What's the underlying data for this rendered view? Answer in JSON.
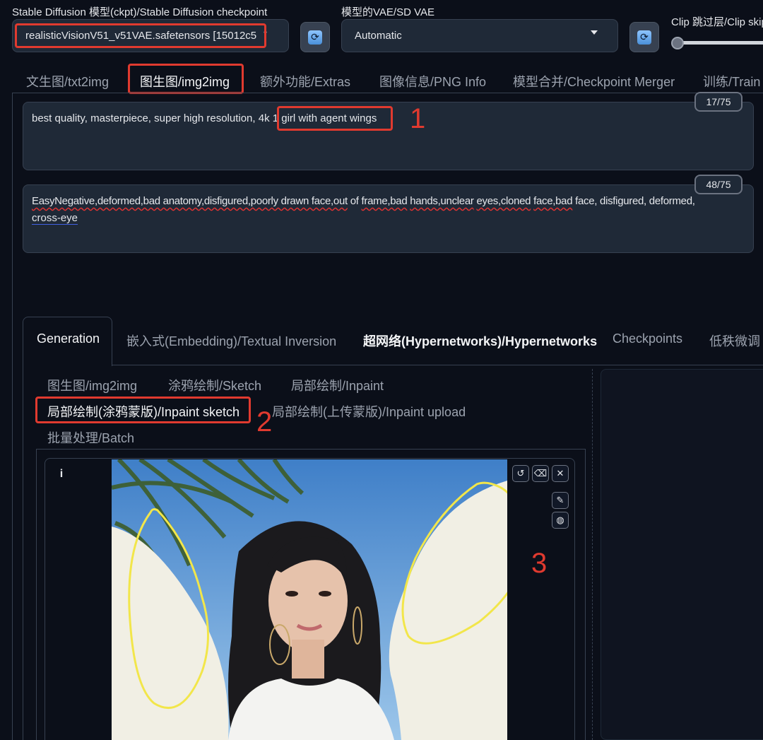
{
  "header": {
    "checkpoint_label": "Stable Diffusion 模型(ckpt)/Stable Diffusion checkpoint",
    "checkpoint_value": "realisticVisionV51_v51VAE.safetensors [15012c5",
    "vae_label": "模型的VAE/SD VAE",
    "vae_value": "Automatic",
    "clip_label": "Clip 跳过层/Clip skip",
    "refresh_icon": "refresh-icon"
  },
  "tabs": [
    {
      "label": "文生图/txt2img"
    },
    {
      "label": "图生图/img2img"
    },
    {
      "label": "额外功能/Extras"
    },
    {
      "label": "图像信息/PNG Info"
    },
    {
      "label": "模型合并/Checkpoint Merger"
    },
    {
      "label": "训练/Train"
    }
  ],
  "prompt": {
    "positive_prefix": "best quality, masterpiece, super high resolution, 4k",
    "positive_highlight": "1 girl with agent wings",
    "positive_count": "17/75",
    "negative_line1": [
      {
        "t": "EasyNegative,deformed,bad anatomy,disfigured,poorly drawn ",
        "w": true
      },
      {
        "t": "face,out",
        "w": true
      },
      {
        "t": " of ",
        "w": false
      },
      {
        "t": "frame,bad",
        "w": true
      },
      {
        "t": " ",
        "w": false
      },
      {
        "t": "hands,unclear",
        "w": true
      },
      {
        "t": " ",
        "w": false
      },
      {
        "t": "eyes,cloned",
        "w": true
      },
      {
        "t": " ",
        "w": false
      },
      {
        "t": "face,bad",
        "w": true
      },
      {
        "t": " face, disfigured, deformed,",
        "w": false
      }
    ],
    "negative_line2": "cross-eye",
    "negative_count": "48/75"
  },
  "gen_tabs": [
    {
      "label": "Generation"
    },
    {
      "label": "嵌入式(Embedding)/Textual Inversion"
    },
    {
      "label": "超网络(Hypernetworks)/Hypernetworks"
    },
    {
      "label": "Checkpoints"
    },
    {
      "label": "低秩微调"
    }
  ],
  "sub_tabs": [
    {
      "label": "图生图/img2img"
    },
    {
      "label": "涂鸦绘制/Sketch"
    },
    {
      "label": "局部绘制/Inpaint"
    },
    {
      "label": "局部绘制(涂鸦蒙版)/Inpaint sketch"
    },
    {
      "label": "局部绘制(上传蒙版)/Inpaint upload"
    },
    {
      "label": "批量处理/Batch"
    }
  ],
  "canvas": {
    "info_glyph": "i",
    "tools": [
      "undo-icon",
      "eraser-icon",
      "close-icon",
      "brush-icon",
      "palette-icon"
    ]
  },
  "annotations": [
    "1",
    "2",
    "3"
  ],
  "colors": {
    "background": "#0b0f19",
    "panel": "#1f2937",
    "annotation_red": "#e03a2f",
    "mask_yellow": "#f2e64a",
    "mask_fill": "#f1efe4"
  }
}
